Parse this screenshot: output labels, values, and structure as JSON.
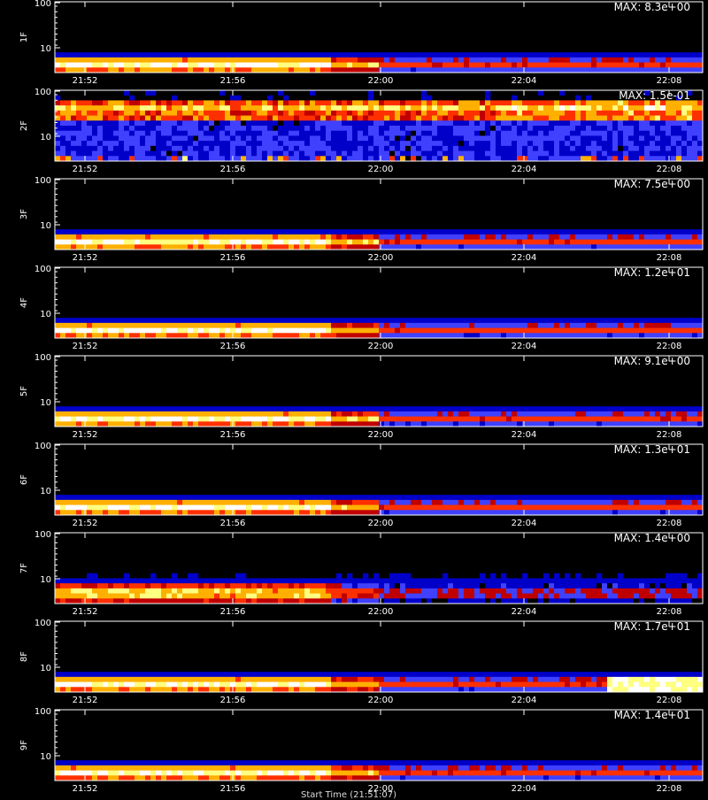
{
  "chart_data": [
    {
      "type": "heatmap",
      "ylabel": "1F",
      "max_label": "MAX: 8.3e+00",
      "profile": "A",
      "y_ticks": [
        "100",
        "10"
      ],
      "x_ticks": [
        "21:52",
        "21:56",
        "22:00",
        "22:04",
        "22:08"
      ],
      "ylim": [
        3,
        100
      ]
    },
    {
      "type": "heatmap",
      "ylabel": "2F",
      "max_label": "MAX: 1.5e-01",
      "profile": "B",
      "y_ticks": [
        "100",
        "10"
      ],
      "x_ticks": [
        "21:52",
        "21:56",
        "22:00",
        "22:04",
        "22:08"
      ],
      "ylim": [
        3,
        100
      ]
    },
    {
      "type": "heatmap",
      "ylabel": "3F",
      "max_label": "MAX: 7.5e+00",
      "profile": "A",
      "y_ticks": [
        "100",
        "10"
      ],
      "x_ticks": [
        "21:52",
        "21:56",
        "22:00",
        "22:04",
        "22:08"
      ],
      "ylim": [
        3,
        100
      ]
    },
    {
      "type": "heatmap",
      "ylabel": "4F",
      "max_label": "MAX: 1.2e+01",
      "profile": "A",
      "y_ticks": [
        "100",
        "10"
      ],
      "x_ticks": [
        "21:52",
        "21:56",
        "22:00",
        "22:04",
        "22:08"
      ],
      "ylim": [
        3,
        100
      ]
    },
    {
      "type": "heatmap",
      "ylabel": "5F",
      "max_label": "MAX: 9.1e+00",
      "profile": "A",
      "y_ticks": [
        "100",
        "10"
      ],
      "x_ticks": [
        "21:52",
        "21:56",
        "22:00",
        "22:04",
        "22:08"
      ],
      "ylim": [
        3,
        100
      ]
    },
    {
      "type": "heatmap",
      "ylabel": "6F",
      "max_label": "MAX: 1.3e+01",
      "profile": "A",
      "y_ticks": [
        "100",
        "10"
      ],
      "x_ticks": [
        "21:52",
        "21:56",
        "22:00",
        "22:04",
        "22:08"
      ],
      "ylim": [
        3,
        100
      ]
    },
    {
      "type": "heatmap",
      "ylabel": "7F",
      "max_label": "MAX: 1.4e+00",
      "profile": "C",
      "y_ticks": [
        "100",
        "10"
      ],
      "x_ticks": [
        "21:52",
        "21:56",
        "22:00",
        "22:04",
        "22:08"
      ],
      "ylim": [
        3,
        100
      ]
    },
    {
      "type": "heatmap",
      "ylabel": "8F",
      "max_label": "MAX: 1.7e+01",
      "profile": "D",
      "y_ticks": [
        "100",
        "10"
      ],
      "x_ticks": [
        "21:52",
        "21:56",
        "22:00",
        "22:04",
        "22:08"
      ],
      "ylim": [
        3,
        100
      ]
    },
    {
      "type": "heatmap",
      "ylabel": "9F",
      "max_label": "MAX: 1.4e+01",
      "profile": "A",
      "y_ticks": [
        "100",
        "10"
      ],
      "x_ticks": [
        "21:52",
        "21:56",
        "22:00",
        "22:04",
        "22:08"
      ],
      "ylim": [
        3,
        100
      ]
    }
  ],
  "xlabel": "Start Time (21:51:07)",
  "colors": {
    "background": "#000000",
    "frame": "#ffffff",
    "colormap": [
      "#000000",
      "#0000c8",
      "#4040ff",
      "#c00000",
      "#ff3000",
      "#ffb000",
      "#ffff80",
      "#ffffff"
    ]
  }
}
